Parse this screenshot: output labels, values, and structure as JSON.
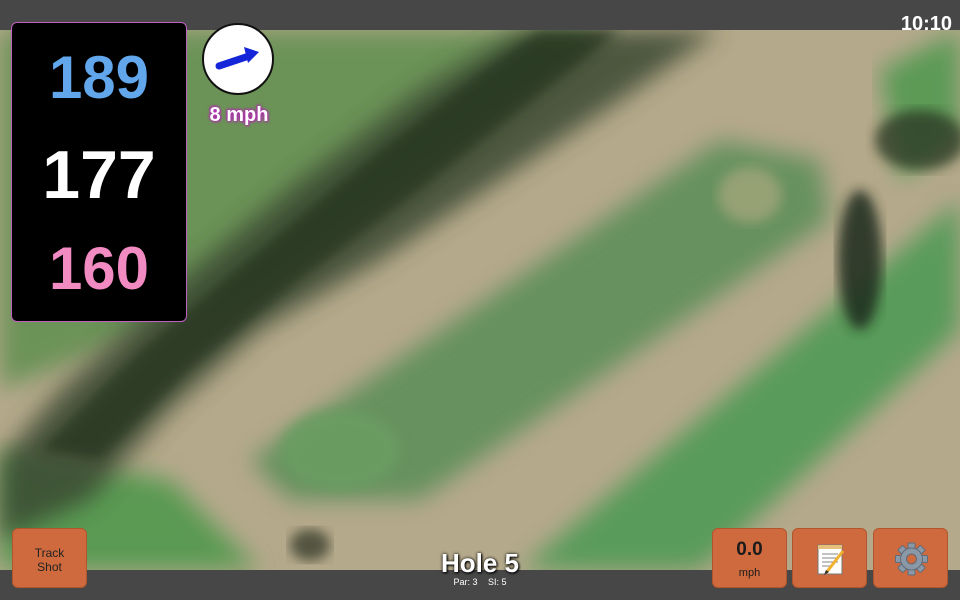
{
  "status": {
    "time": "10:10"
  },
  "distances": {
    "back": "189",
    "middle": "177",
    "front": "160"
  },
  "wind": {
    "speed_label": "8 mph",
    "arrow_icon": "wind-arrow-icon"
  },
  "hole": {
    "title": "Hole 5",
    "par": "Par: 3",
    "si": "SI: 5"
  },
  "buttons": {
    "track_shot_line1": "Track",
    "track_shot_line2": "Shot",
    "speed_value": "0.0",
    "speed_unit": "mph",
    "notes_icon": "notepad-icon",
    "settings_icon": "gear-icon"
  },
  "colors": {
    "back_distance": "#62a6ec",
    "middle_distance": "#ffffff",
    "front_distance": "#f38bc3",
    "button_bg": "#cf6a3e"
  }
}
